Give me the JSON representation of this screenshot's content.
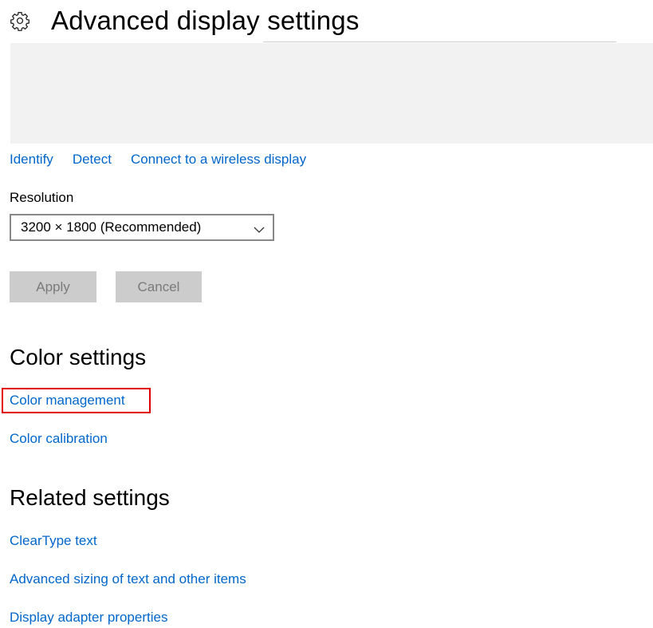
{
  "header": {
    "title": "Advanced display settings",
    "icon": "gear-icon"
  },
  "display_links": [
    {
      "label": "Identify"
    },
    {
      "label": "Detect"
    },
    {
      "label": "Connect to a wireless display"
    }
  ],
  "resolution": {
    "label": "Resolution",
    "selected": "3200 × 1800 (Recommended)"
  },
  "buttons": {
    "apply": "Apply",
    "cancel": "Cancel"
  },
  "color_settings": {
    "title": "Color settings",
    "links": [
      {
        "label": "Color management"
      },
      {
        "label": "Color calibration"
      }
    ]
  },
  "related_settings": {
    "title": "Related settings",
    "links": [
      {
        "label": "ClearType text"
      },
      {
        "label": "Advanced sizing of text and other items"
      },
      {
        "label": "Display adapter properties"
      }
    ]
  },
  "colors": {
    "link": "#0066cc",
    "highlight": "#e00000",
    "button_bg": "#cccccc",
    "display_area_bg": "#f2f2f2"
  }
}
